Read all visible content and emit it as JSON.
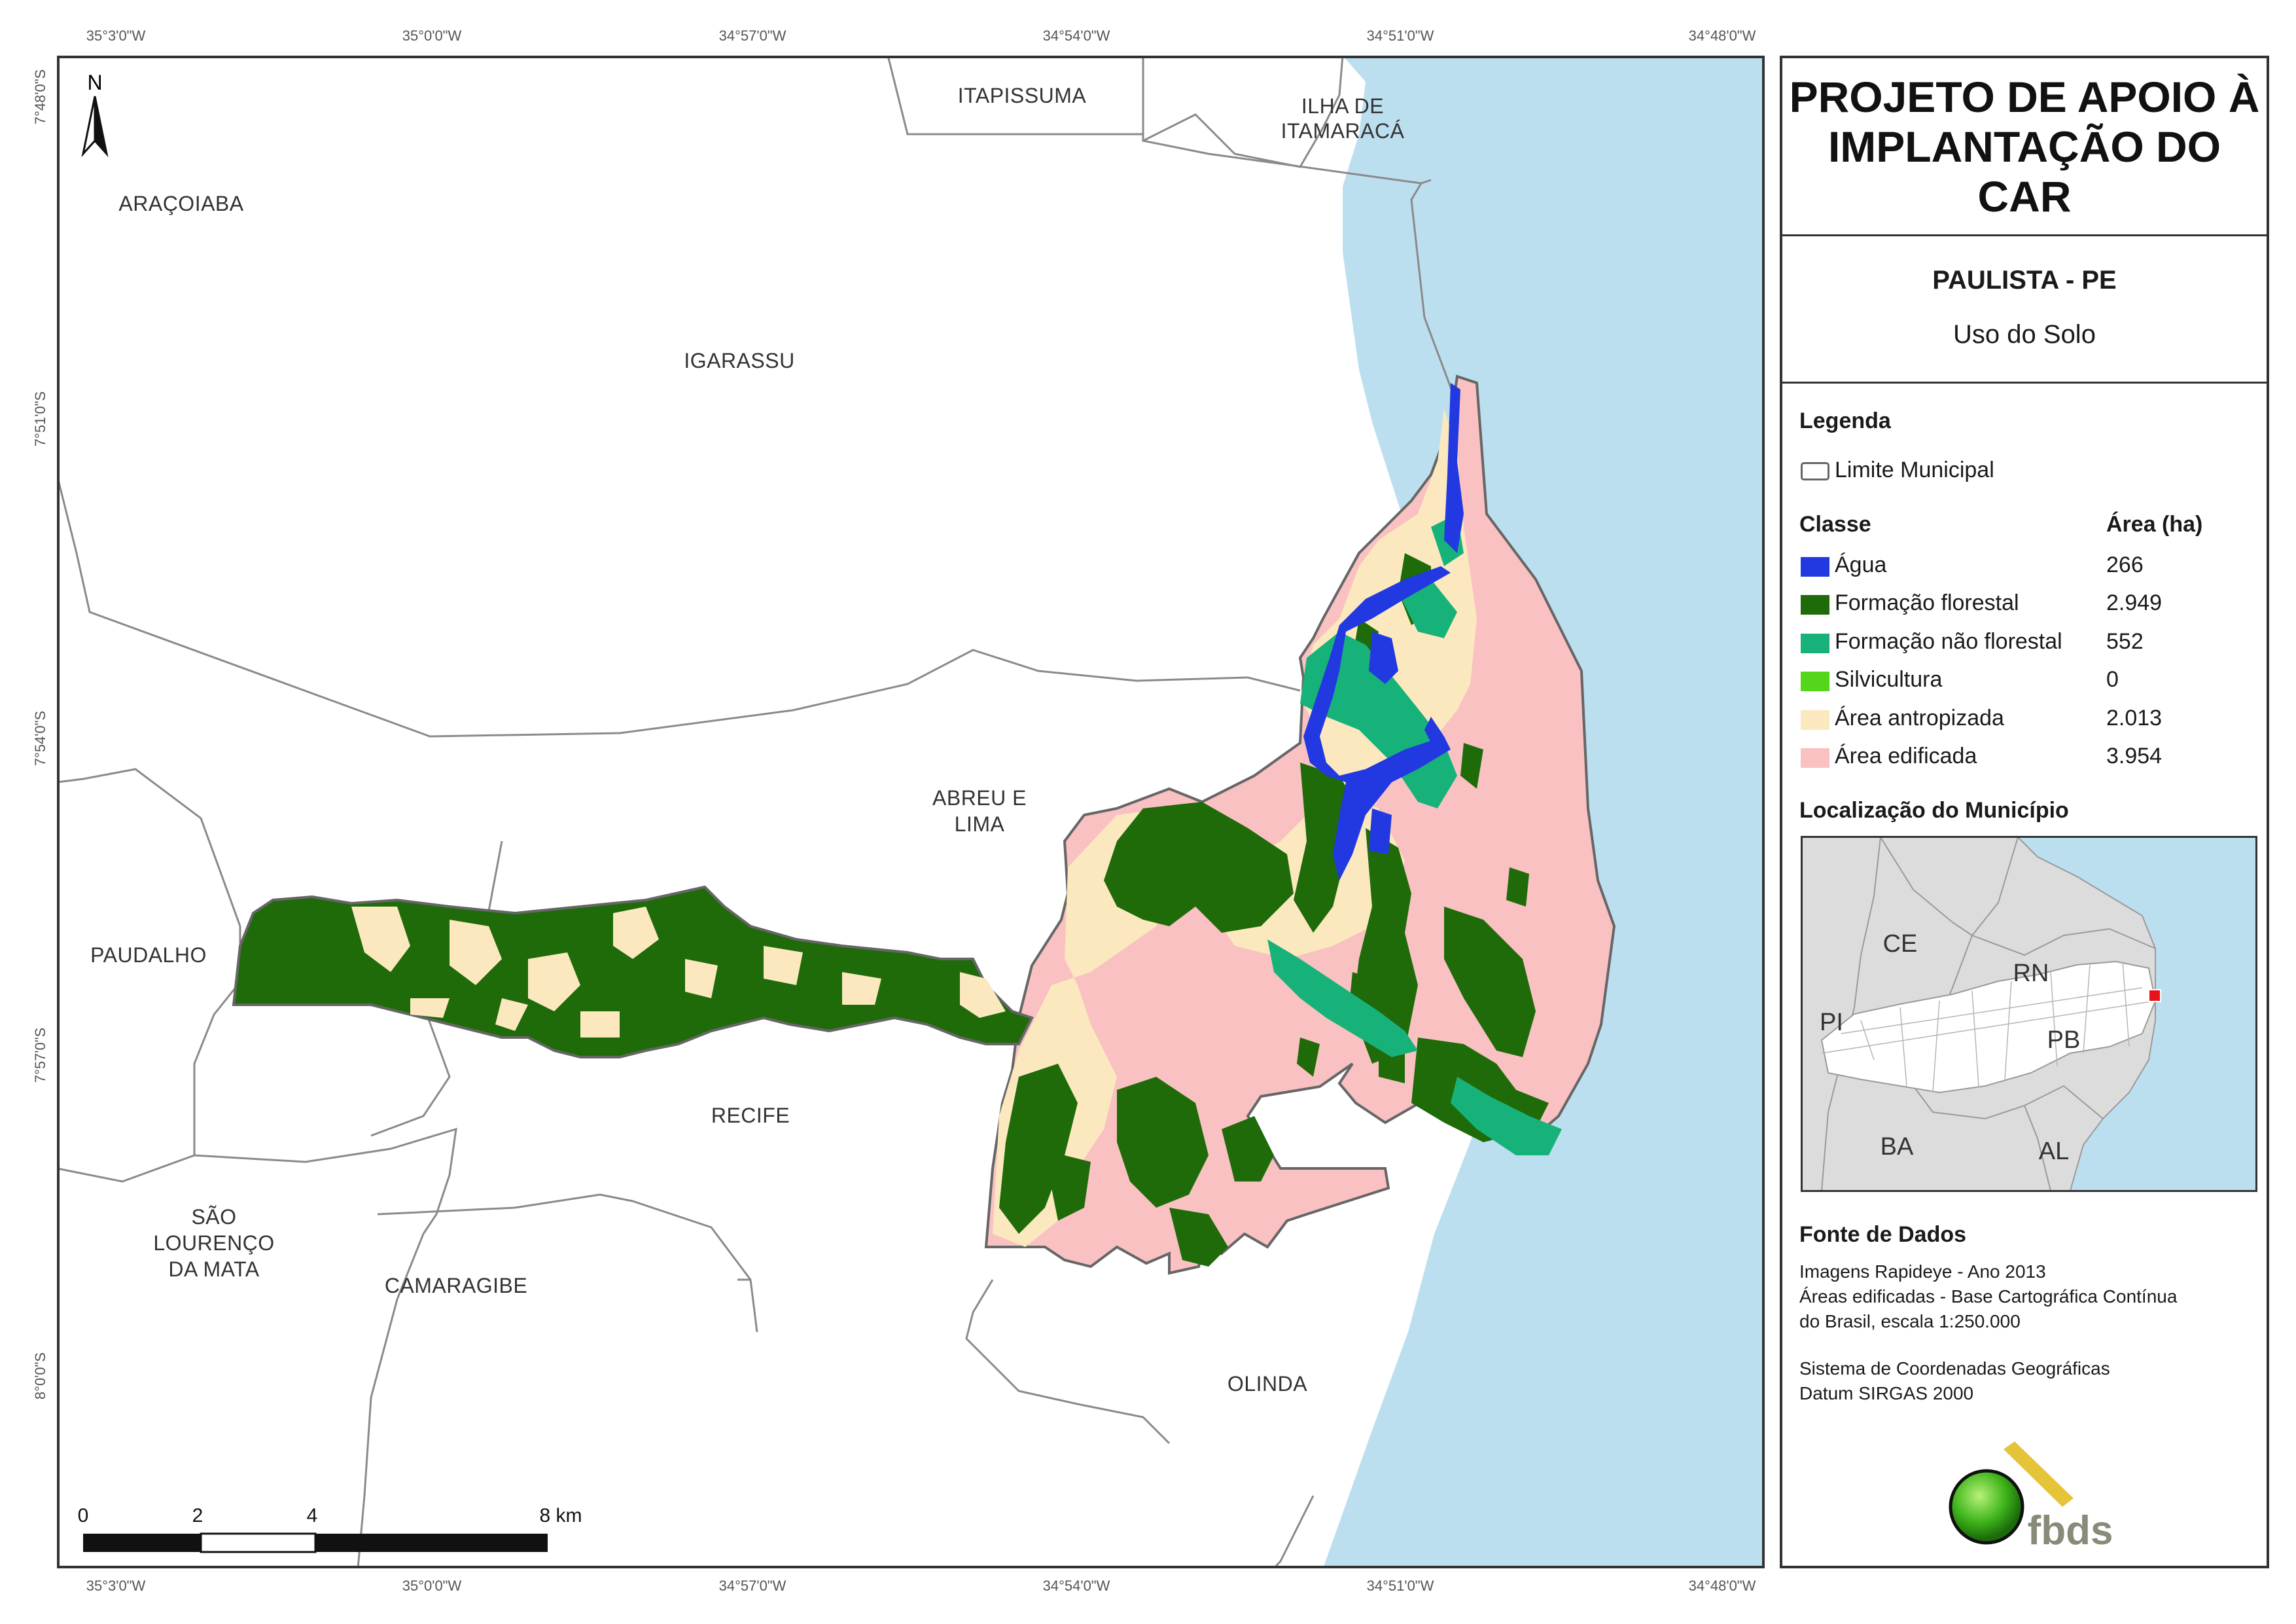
{
  "coords": {
    "top": [
      "35°3'0\"W",
      "35°0'0\"W",
      "34°57'0\"W",
      "34°54'0\"W",
      "34°51'0\"W",
      "34°48'0\"W"
    ],
    "bottom": [
      "35°3'0\"W",
      "35°0'0\"W",
      "34°57'0\"W",
      "34°54'0\"W",
      "34°51'0\"W",
      "34°48'0\"W"
    ],
    "left": [
      "7°48'0\"S",
      "7°51'0\"S",
      "7°54'0\"S",
      "7°57'0\"S",
      "8°0'0\"S"
    ]
  },
  "map": {
    "north_label": "N",
    "municipalities": {
      "aracoiaba": "ARAÇOIABA",
      "itapissuma": "ITAPISSUMA",
      "ilha_1": "ILHA DE",
      "ilha_2": "ITAMARACÁ",
      "igarassu": "IGARASSU",
      "abreu_1": "ABREU E",
      "abreu_2": "LIMA",
      "paudalho": "PAUDALHO",
      "recife": "RECIFE",
      "sao_1": "SÃO",
      "sao_2": "LOURENÇO",
      "sao_3": "DA MATA",
      "camaragibe": "CAMARAGIBE",
      "olinda": "OLINDA"
    },
    "scale": {
      "t0": "0",
      "t2": "2",
      "t4": "4",
      "t8": "8 km"
    }
  },
  "panel": {
    "title_1": "PROJETO DE APOIO À",
    "title_2": "IMPLANTAÇÃO DO CAR",
    "subtitle": "PAULISTA - PE",
    "subtitle2": "Uso do Solo",
    "legend_title": "Legenda",
    "limit_label": "Limite Municipal",
    "class_header": "Classe",
    "area_header": "Área (ha)",
    "classes": [
      {
        "label": "Água",
        "area": "266",
        "color": "#2238e0"
      },
      {
        "label": "Formação florestal",
        "area": "2.949",
        "color": "#1f6b0a"
      },
      {
        "label": "Formação não florestal",
        "area": "552",
        "color": "#17b27a"
      },
      {
        "label": "Silvicultura",
        "area": "0",
        "color": "#54d61a"
      },
      {
        "label": "Área antropizada",
        "area": "2.013",
        "color": "#fbe8bf"
      },
      {
        "label": "Área edificada",
        "area": "3.954",
        "color": "#f9c1c1"
      }
    ],
    "location_title": "Localização do Município",
    "inset_labels": {
      "ce": "CE",
      "rn": "RN",
      "pi": "PI",
      "pb": "PB",
      "ba": "BA",
      "al": "AL"
    },
    "source_title": "Fonte de Dados",
    "source_lines": [
      "Imagens Rapideye - Ano 2013",
      "Áreas edificadas - Base Cartográfica Contínua",
      "do Brasil, escala 1:250.000",
      "",
      "Sistema de Coordenadas Geográficas",
      "Datum SIRGAS 2000"
    ],
    "logo_text": "fbds"
  },
  "colors": {
    "ocean": "#bcdff0",
    "land": "#ffffff",
    "border": "#8a8a8a",
    "paulista_border": "#666666",
    "panel_border": "#333333"
  }
}
